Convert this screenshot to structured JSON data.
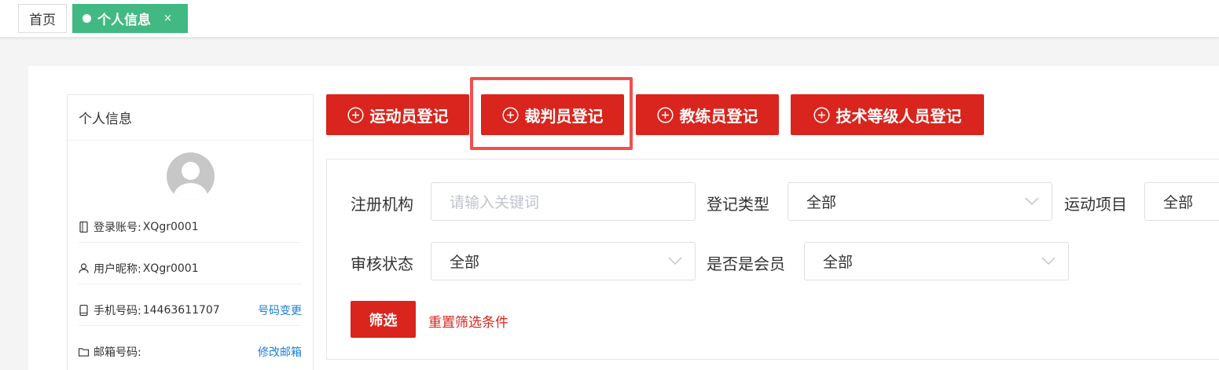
{
  "tabs": {
    "home_label": "首页",
    "active_label": "个人信息",
    "close_glyph": "×"
  },
  "profile": {
    "title": "个人信息",
    "rows": [
      {
        "icon": "mobile-icon",
        "label": "登录账号:",
        "value": "XQgr0001",
        "link": ""
      },
      {
        "icon": "user-icon",
        "label": "用户昵称:",
        "value": "XQgr0001",
        "link": ""
      },
      {
        "icon": "phone-icon",
        "label": "手机号码:",
        "value": "14463611707",
        "link": "号码变更"
      },
      {
        "icon": "folder-icon",
        "label": "邮箱号码:",
        "value": "",
        "link": "修改邮箱"
      }
    ]
  },
  "actions": {
    "athlete": "运动员登记",
    "referee": "裁判员登记",
    "coach": "教练员登记",
    "technical": "技术等级人员登记"
  },
  "filters": {
    "org_label": "注册机构",
    "org_placeholder": "请输入关键词",
    "type_label": "登记类型",
    "type_value": "全部",
    "sport_label": "运动项目",
    "sport_value": "全部",
    "review_label": "审核状态",
    "review_value": "全部",
    "member_label": "是否是会员",
    "member_value": "全部",
    "filter_button": "筛选",
    "reset_link": "重置筛选条件"
  },
  "colors": {
    "primary_red": "#d9251d",
    "tab_green": "#42b983",
    "highlight": "#f05050",
    "link_blue": "#1a7fd4"
  }
}
